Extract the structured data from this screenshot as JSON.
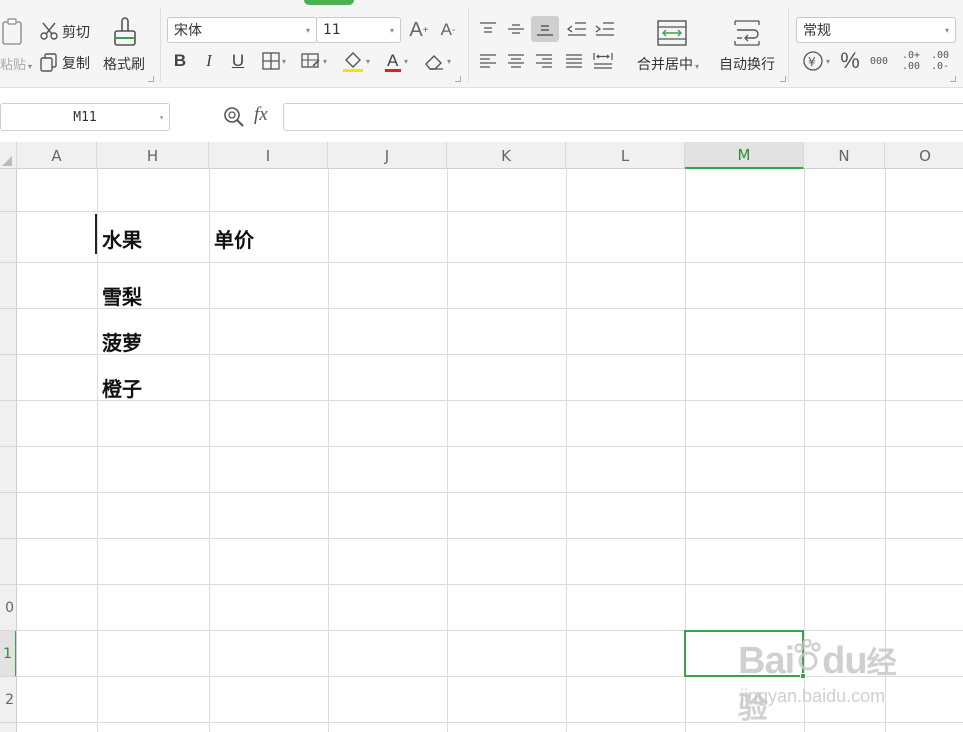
{
  "ribbon": {
    "paste_label": "粘贴",
    "cut_label": "剪切",
    "copy_label": "复制",
    "format_painter_label": "格式刷",
    "font_name": "宋体",
    "font_size": "11",
    "merge_center_label": "合并居中",
    "wrap_text_label": "自动换行",
    "number_format": "常规",
    "percent_symbol": "%",
    "thousands_symbol": "000",
    "increase_decimal": ".0+ .00",
    "decrease_decimal": ".00 .0-"
  },
  "formula_bar": {
    "cell_name": "M11",
    "fx_label": "fx",
    "value": ""
  },
  "columns": [
    {
      "label": "A"
    },
    {
      "label": "H"
    },
    {
      "label": "I"
    },
    {
      "label": "J"
    },
    {
      "label": "K"
    },
    {
      "label": "L"
    },
    {
      "label": "M",
      "active": true
    },
    {
      "label": "N"
    },
    {
      "label": "O"
    }
  ],
  "rows": [
    {
      "label": ""
    },
    {
      "label": ""
    },
    {
      "label": ""
    },
    {
      "label": ""
    },
    {
      "label": ""
    },
    {
      "label": ""
    },
    {
      "label": ""
    },
    {
      "label": ""
    },
    {
      "label": ""
    },
    {
      "label": "0"
    },
    {
      "label": "1",
      "active": true
    },
    {
      "label": "2"
    }
  ],
  "cells": {
    "h_header": "水果",
    "i_header": "单价",
    "fruit_1": "雪梨",
    "fruit_2": "菠萝",
    "fruit_3": "橙子"
  },
  "watermark": {
    "brand": "Bai",
    "brand2": "du",
    "suffix": "经验",
    "url": "jingyan.baidu.com"
  },
  "colors": {
    "accent_green": "#3aa24a",
    "font_color_underline": "#e02020",
    "highlight_underline": "#f5e400"
  }
}
